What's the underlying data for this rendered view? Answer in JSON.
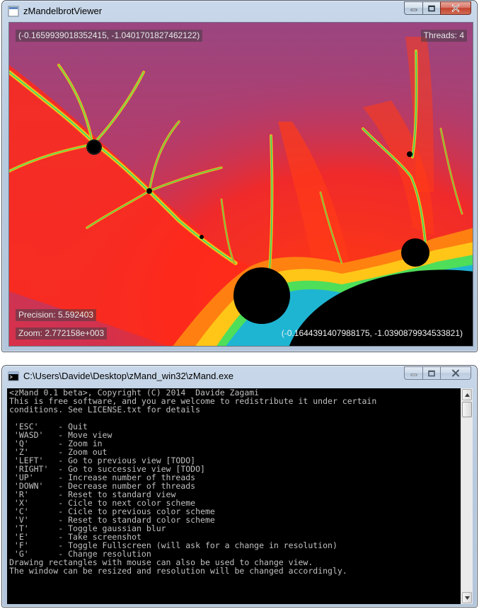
{
  "mandel_window": {
    "title": "zMandelbrotViewer",
    "top_left_coord": "(-0.1659939018352415, -1.0401701827462122)",
    "threads": "Threads: 4",
    "precision": "Precision: 5.592403",
    "zoom": "Zoom: 2.772158e+003",
    "bottom_right_coord": "(-0.1644391407988175, -1.0390879934533821)",
    "icon": "app-icon"
  },
  "console_window": {
    "title": "C:\\Users\\Davide\\Desktop\\zMand_win32\\zMand.exe",
    "icon": "console-icon",
    "lines": [
      "<zMand 0.1 beta>, Copyright (C) 2014  Davide Zagami",
      "This is free software, and you are welcome to redistribute it under certain",
      "conditions. See LICENSE.txt for details",
      "",
      " 'ESC'    - Quit",
      " 'WASD'   - Move view",
      " 'Q'      - Zoom in",
      " 'Z'      - Zoom out",
      " 'LEFT'   - Go to previous view [TODO]",
      " 'RIGHT'  - Go to successive view [TODO]",
      " 'UP'     - Increase number of threads",
      " 'DOWN'   - Decrease number of threads",
      " 'R'      - Reset to standard view",
      " 'X'      - Cicle to next color scheme",
      " 'C'      - Cicle to previous color scheme",
      " 'V'      - Reset to standard color scheme",
      " 'T'      - Toggle gaussian blur",
      " 'E'      - Take screenshot",
      " 'F'      - Toggle Fullscreen (will ask for a change in resolution)",
      " 'G'      - Change resolution",
      "Drawing rectangles with mouse can also be used to change view.",
      "The window can be resized and resolution will be changed accordingly."
    ]
  },
  "window_controls": {
    "minimize": "minimize-icon",
    "maximize": "maximize-icon",
    "close": "close-icon"
  },
  "colors": {
    "fractal_background": "#a3457b",
    "fractal_red": "#ff2a1a",
    "fractal_set": "#000000",
    "console_background": "#000000",
    "console_text": "#c0c0c0"
  }
}
